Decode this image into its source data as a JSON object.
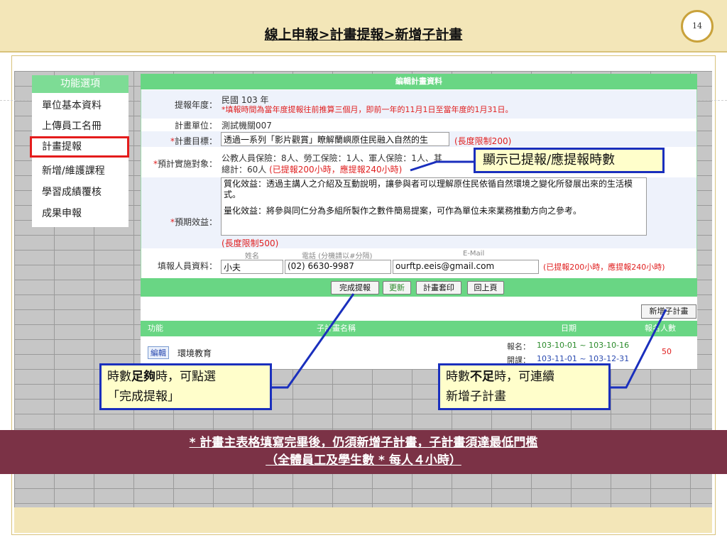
{
  "slide": {
    "title": "線上申報>計畫提報>新增子計畫",
    "page_number": "14"
  },
  "sidebar": {
    "header": "功能選項",
    "items": [
      {
        "label": "單位基本資料"
      },
      {
        "label": "上傳員工名冊"
      },
      {
        "label": "計畫提報"
      },
      {
        "label": "新增/維護課程"
      },
      {
        "label": "學習成績覆核"
      },
      {
        "label": "成果申報"
      }
    ],
    "selected_index": 2
  },
  "form": {
    "title": "編輯計畫資料",
    "year_label": "提報年度：",
    "year_value": "民國 103 年",
    "year_note": "*填報時間為當年度提報往前推算三個月，即前一年的11月1日至當年度的1月31日。",
    "unit_label": "計畫單位：",
    "unit_value": "測試機關007",
    "goal_label_req": "*",
    "goal_label": "計畫目標：",
    "goal_value": "透過一系列「影片觀賞」瞭解蘭嶼原住民融入自然的生",
    "goal_limit": "(長度限制200)",
    "target_label_req": "*",
    "target_label": "預計實施對象：",
    "target_line1": "公教人員保險：8人、勞工保險：1人、軍人保險：1人、其",
    "target_total": "總計：60人",
    "target_hours": "(已提報200小時，應提報240小時)",
    "benefit_label_req": "*",
    "benefit_label": "預期效益：",
    "benefit_text1": "質化效益：透過主講人之介紹及互動說明，讓參與者可以理解原住民依循自然環境之變化所發展出來的生活模式。",
    "benefit_text2": "量化效益：將參與同仁分為多組所製作之數件簡易提案，可作為單位未來業務推動方向之參考。",
    "benefit_limit": "(長度限制500)",
    "filler_label": "填報人員資料：",
    "filler_name_header": "姓名",
    "filler_phone_header": "電話 (分機請以#分隔)",
    "filler_email_header": "E-Mail",
    "filler_name": "小夫",
    "filler_phone": "(02) 6630-9987",
    "filler_email": "ourftp.eeis@gmail.com",
    "filler_hours": "(已提報200小時，應提報240小時)",
    "buttons": {
      "complete": "完成提報",
      "update": "更新",
      "print": "計畫套印",
      "back": "回上頁"
    }
  },
  "list": {
    "add_button": "新增子計畫",
    "headers": {
      "func": "功能",
      "name": "子計畫名稱",
      "date": "日期",
      "count": "報名人數"
    },
    "rows": [
      {
        "edit": "編輯",
        "name": "環境教育",
        "signup_label": "報名：",
        "signup_dates": "103-10-01 ~ 103-10-16",
        "class_label": "開課：",
        "class_dates": "103-11-01 ~ 103-12-31",
        "count": "50"
      }
    ]
  },
  "callouts": {
    "hours_display": "顯示已提報/應提報時數",
    "enough_pre": "時數",
    "enough_bold": "足夠",
    "enough_post": "時，可點選",
    "enough_line2": "「完成提報」",
    "short_pre": "時數",
    "short_bold": "不足",
    "short_post": "時，可連續",
    "short_line2": "新增子計畫"
  },
  "banner": {
    "line1": "* 計畫主表格填寫完畢後，仍須新增子計畫，子計畫須達最低門檻",
    "line2": "（全體員工及學生數 * 每人４小時）"
  },
  "colors": {
    "header_band": "#f3e6b8",
    "green_header": "#69d684",
    "banner": "#7b3246",
    "callout_border": "#1a2fbd",
    "callout_fill": "#fffecb",
    "highlight_red": "#e41c1c"
  }
}
